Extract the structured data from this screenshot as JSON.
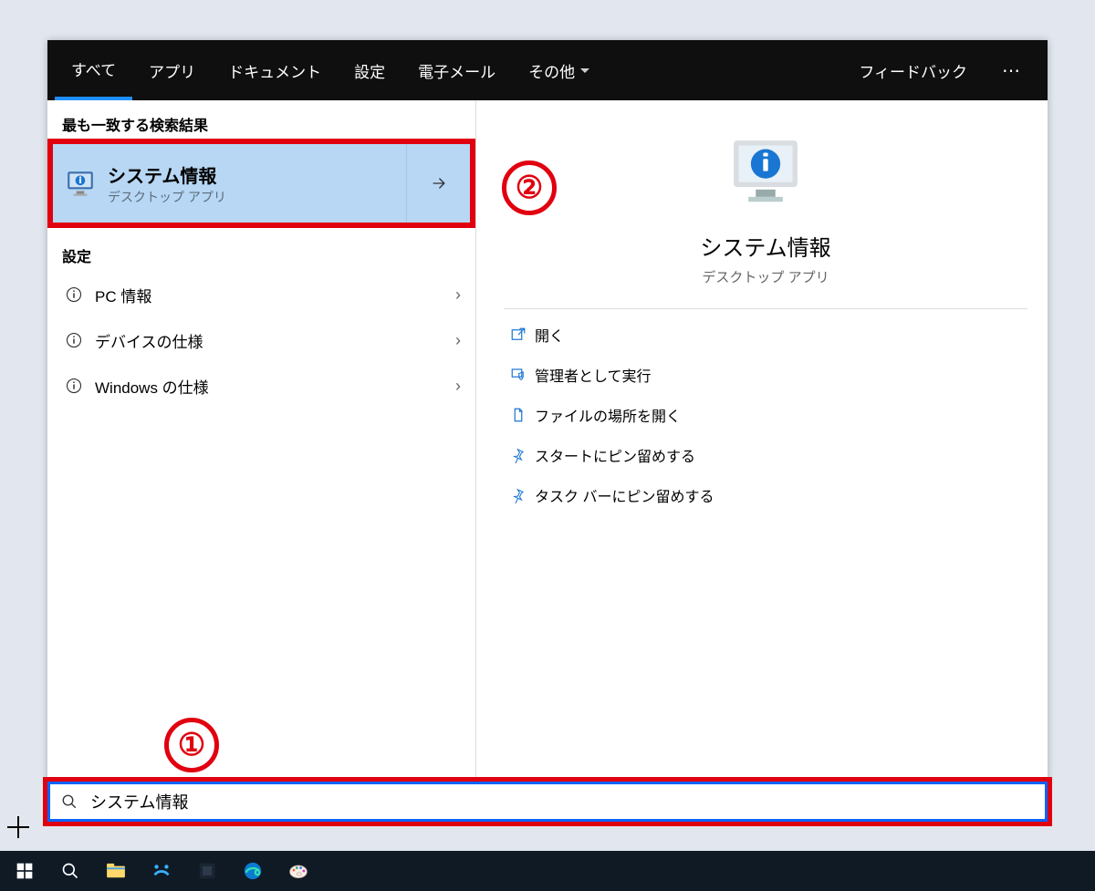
{
  "tabs": {
    "items": [
      "すべて",
      "アプリ",
      "ドキュメント",
      "設定",
      "電子メール",
      "その他"
    ],
    "feedback": "フィードバック"
  },
  "left": {
    "best_label": "最も一致する検索結果",
    "best": {
      "title": "システム情報",
      "subtitle": "デスクトップ アプリ"
    },
    "settings_label": "設定",
    "settings_items": [
      "PC 情報",
      "デバイスの仕様",
      "Windows の仕様"
    ]
  },
  "right": {
    "title": "システム情報",
    "subtitle": "デスクトップ アプリ",
    "actions": [
      "開く",
      "管理者として実行",
      "ファイルの場所を開く",
      "スタートにピン留めする",
      "タスク バーにピン留めする"
    ]
  },
  "search": {
    "value": "システム情報"
  },
  "annotations": {
    "a1": "①",
    "a2": "②"
  }
}
